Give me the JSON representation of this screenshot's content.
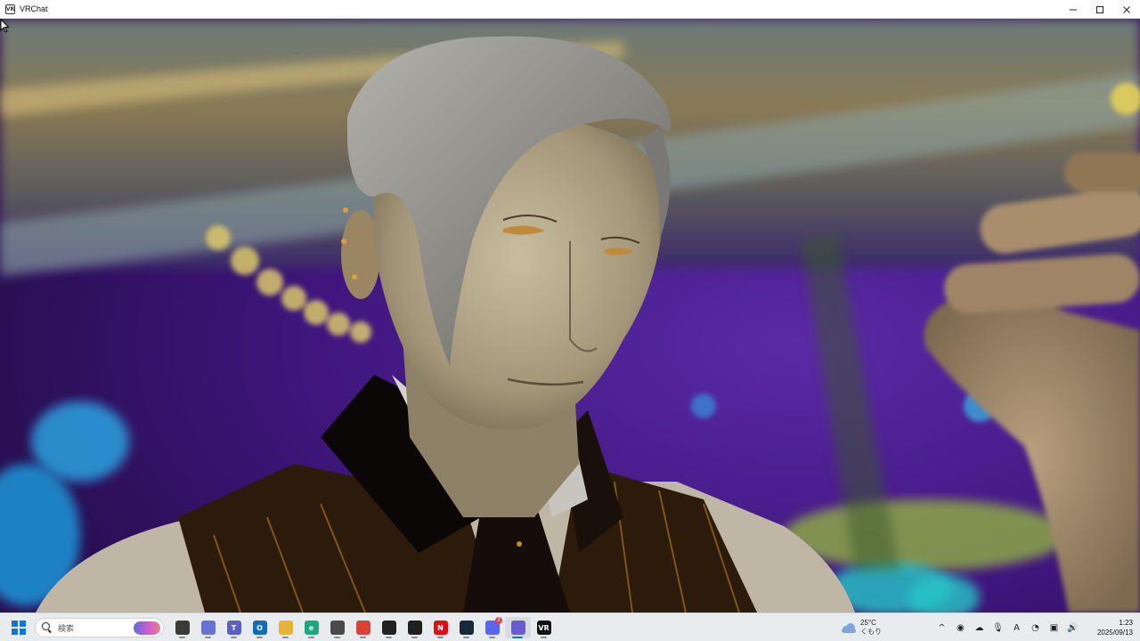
{
  "window": {
    "title": "VRChat",
    "app_icon_text": "VR",
    "controls": {
      "minimize": "minimize-icon",
      "maximize": "maximize-icon",
      "close": "close-icon"
    }
  },
  "viewport": {
    "scene": "vrchat-avatar-closeup",
    "palette": {
      "purple": "#4a1a8c",
      "gold": "#c9a24a",
      "skin": "#b5a98b",
      "hair": "#8c8a86",
      "vest": "#2a1a0c"
    }
  },
  "taskbar": {
    "search": {
      "placeholder": "検索"
    },
    "apps": [
      {
        "name": "task-view",
        "icon": "task-view-icon",
        "color": "#3b3b3b",
        "glyph": ""
      },
      {
        "name": "copilot",
        "icon": "copilot-icon",
        "color": "#6b72d6",
        "glyph": ""
      },
      {
        "name": "teams",
        "icon": "teams-icon",
        "color": "#5b5fc7",
        "glyph": "T"
      },
      {
        "name": "outlook",
        "icon": "outlook-icon",
        "color": "#0f6cbd",
        "glyph": "O"
      },
      {
        "name": "file-explorer",
        "icon": "folder-icon",
        "color": "#e8b23a",
        "glyph": ""
      },
      {
        "name": "edge",
        "icon": "edge-icon",
        "color": "#1fa67a",
        "glyph": "e"
      },
      {
        "name": "store",
        "icon": "store-icon",
        "color": "#4a4a4a",
        "glyph": ""
      },
      {
        "name": "chrome",
        "icon": "chrome-icon",
        "color": "#d94235",
        "glyph": ""
      },
      {
        "name": "obs",
        "icon": "obs-icon",
        "color": "#222222",
        "glyph": ""
      },
      {
        "name": "chatgpt",
        "icon": "chatgpt-icon",
        "color": "#1f1f1f",
        "glyph": ""
      },
      {
        "name": "netflix",
        "icon": "netflix-icon",
        "color": "#e50914",
        "glyph": "N"
      },
      {
        "name": "steam",
        "icon": "steam-icon",
        "color": "#1b2838",
        "glyph": ""
      },
      {
        "name": "discord",
        "icon": "discord-icon",
        "color": "#5865f2",
        "glyph": "",
        "badge": "2"
      },
      {
        "name": "app-active",
        "icon": "vr-app-icon",
        "color": "#6a5acd",
        "glyph": "",
        "active": true
      },
      {
        "name": "vrchat",
        "icon": "vrchat-icon",
        "color": "#111111",
        "glyph": "VR"
      }
    ],
    "weather": {
      "temp": "25°C",
      "condition": "くもり",
      "icon": "cloud-icon"
    },
    "tray": [
      {
        "name": "overflow",
        "icon": "chevron-up-icon",
        "glyph": "^"
      },
      {
        "name": "discord-tray",
        "icon": "discord-tray-icon",
        "glyph": "◉"
      },
      {
        "name": "cloud-tray",
        "icon": "cloud-tray-icon",
        "glyph": "☁"
      },
      {
        "name": "mic",
        "icon": "microphone-icon",
        "glyph": "🎙"
      },
      {
        "name": "ime",
        "icon": "ime-icon",
        "glyph": "A"
      },
      {
        "name": "sync",
        "icon": "sync-icon",
        "glyph": "◔"
      },
      {
        "name": "network",
        "icon": "network-icon",
        "glyph": "▣"
      },
      {
        "name": "volume",
        "icon": "volume-icon",
        "glyph": "🔊"
      }
    ],
    "clock": {
      "time": "1:23",
      "date": "2025/09/13"
    }
  }
}
